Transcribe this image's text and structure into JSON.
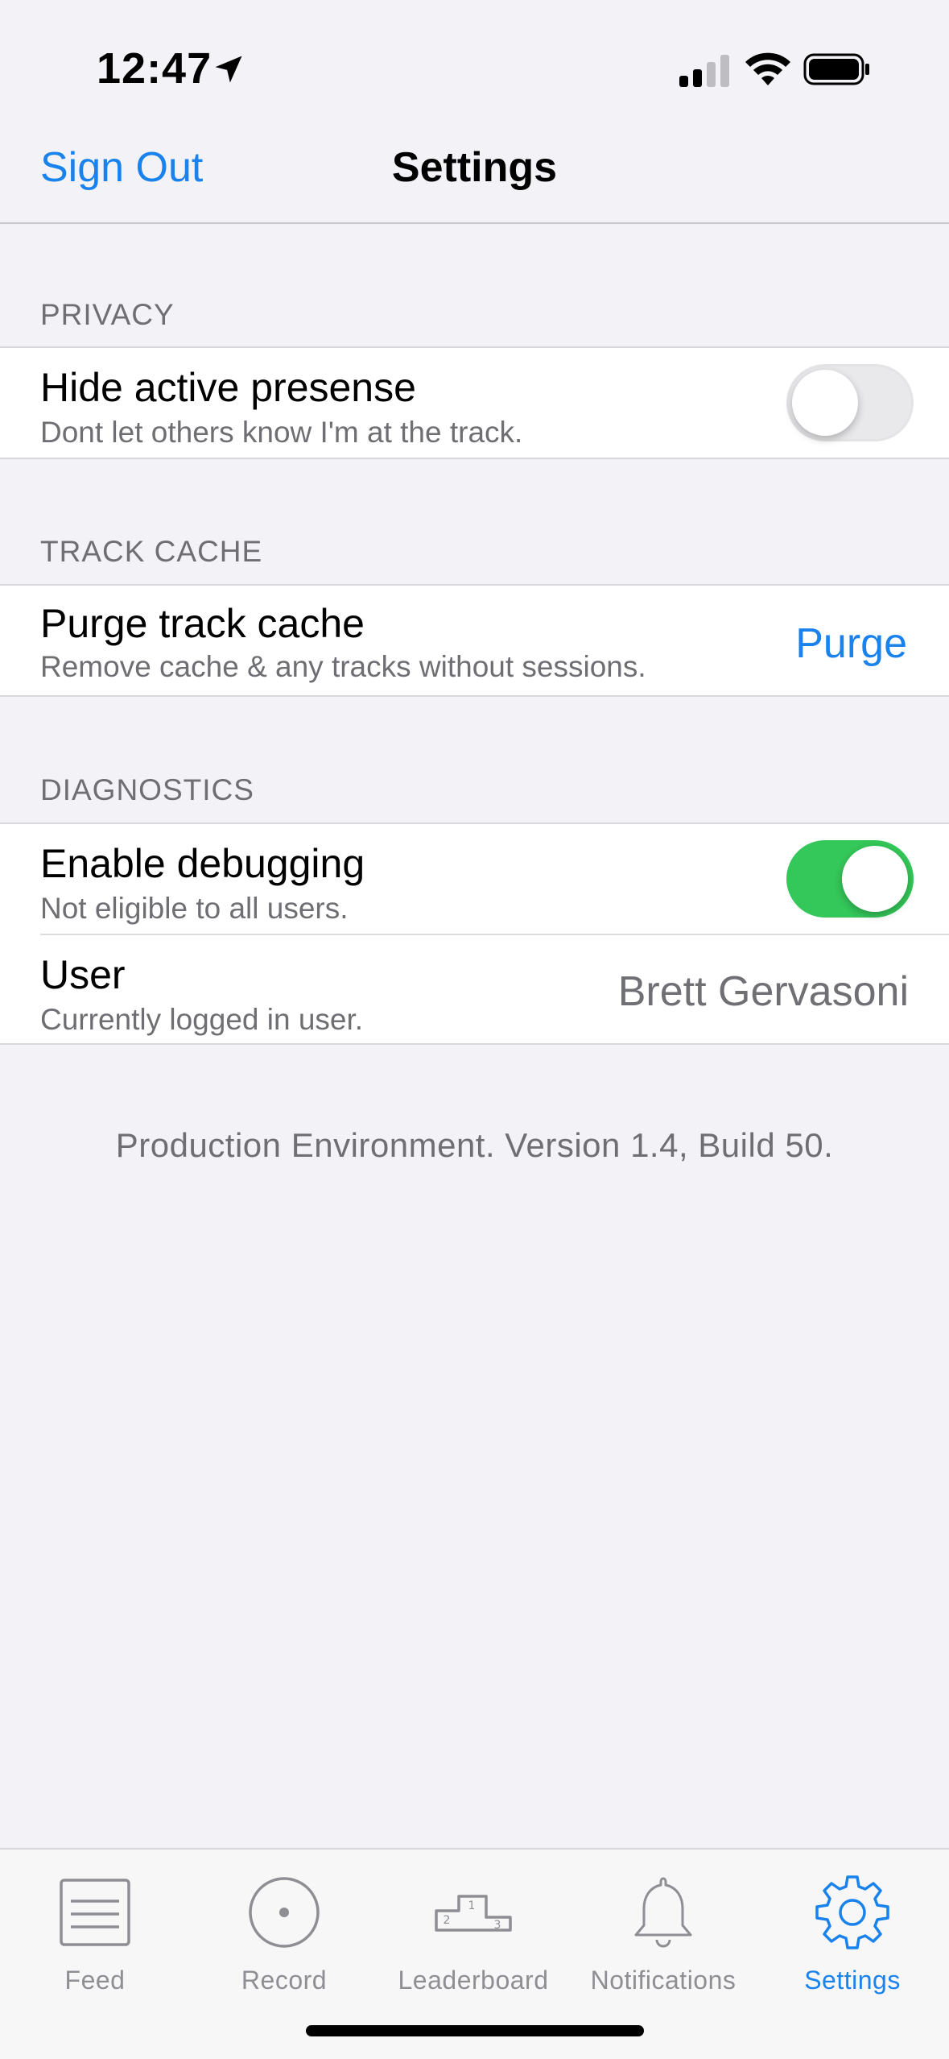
{
  "status_bar": {
    "time": "12:47",
    "icons": [
      "location-arrow-icon",
      "cellular-signal-icon",
      "wifi-icon",
      "battery-icon"
    ]
  },
  "nav": {
    "sign_out_label": "Sign Out",
    "title": "Settings"
  },
  "sections": {
    "privacy": {
      "header": "PRIVACY",
      "hide_presence": {
        "title": "Hide active presense",
        "subtitle": "Dont let others know I'm at the track.",
        "enabled": false
      }
    },
    "track_cache": {
      "header": "TRACK CACHE",
      "purge": {
        "title": "Purge track cache",
        "subtitle": "Remove cache & any tracks without sessions.",
        "action_label": "Purge"
      }
    },
    "diagnostics": {
      "header": "DIAGNOSTICS",
      "debugging": {
        "title": "Enable debugging",
        "subtitle": "Not eligible to all users.",
        "enabled": true
      },
      "user": {
        "title": "User",
        "subtitle": "Currently logged in user.",
        "value": "Brett Gervasoni"
      }
    }
  },
  "footer": "Production Environment. Version 1.4, Build 50.",
  "tab_bar": {
    "tabs": [
      {
        "label": "Feed",
        "icon": "feed-icon",
        "active": false
      },
      {
        "label": "Record",
        "icon": "record-icon",
        "active": false
      },
      {
        "label": "Leaderboard",
        "icon": "podium-icon",
        "active": false
      },
      {
        "label": "Notifications",
        "icon": "bell-icon",
        "active": false
      },
      {
        "label": "Settings",
        "icon": "gear-icon",
        "active": true
      }
    ]
  },
  "colors": {
    "accent": "#1a82ec",
    "toggle_on": "#34c759",
    "background": "#f2f2f7",
    "secondary_text": "#6e6e73"
  }
}
